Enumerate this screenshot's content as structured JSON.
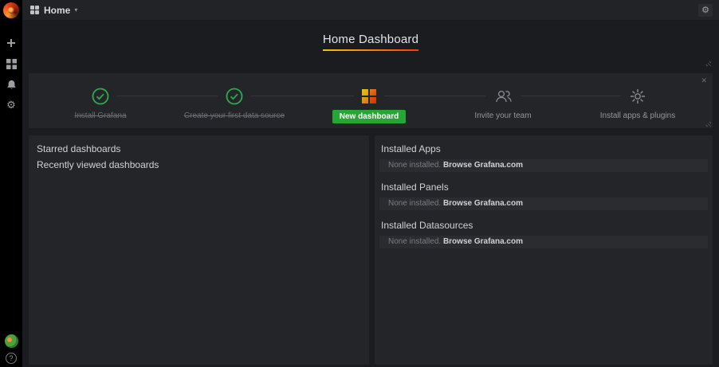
{
  "topnav": {
    "home_label": "Home",
    "caret": "▾",
    "gear_glyph": "⚙"
  },
  "sidebar": {
    "help_glyph": "?"
  },
  "dashboard": {
    "title": "Home Dashboard"
  },
  "steps": {
    "close_glyph": "✕",
    "items": [
      {
        "label": "Install Grafana",
        "state": "done"
      },
      {
        "label": "Create your first data source",
        "state": "done"
      },
      {
        "label": "New dashboard",
        "state": "cta"
      },
      {
        "label": "Invite your team",
        "state": "todo"
      },
      {
        "label": "Install apps & plugins",
        "state": "todo"
      }
    ]
  },
  "left_panel": {
    "starred_heading": "Starred dashboards",
    "recent_heading": "Recently viewed dashboards"
  },
  "right_panel": {
    "sections": [
      {
        "heading": "Installed Apps",
        "empty_text": "None installed. ",
        "link_text": "Browse Grafana.com"
      },
      {
        "heading": "Installed Panels",
        "empty_text": "None installed. ",
        "link_text": "Browse Grafana.com"
      },
      {
        "heading": "Installed Datasources",
        "empty_text": "None installed. ",
        "link_text": "Browse Grafana.com"
      }
    ]
  },
  "colors": {
    "cta_green": "#26a635",
    "check_green": "#2daa4f",
    "title_underline_from": "#f2c40c",
    "title_underline_to": "#ff3b0a",
    "panel_bg": "#242528",
    "page_bg": "#1b1c1f",
    "sidebar_bg": "#000000"
  }
}
